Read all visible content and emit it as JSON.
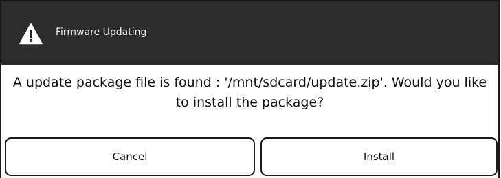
{
  "dialog": {
    "title": "Firmware Updating",
    "icon": "warning-icon",
    "message": "A update package file is found : '/mnt/sdcard/update.zip'. Would you like to install the package?",
    "buttons": {
      "cancel_label": "Cancel",
      "install_label": "Install"
    }
  },
  "colors": {
    "titlebar": "#2c2c2c",
    "title_text": "#f0f0f0",
    "border": "#1a1a1a"
  }
}
